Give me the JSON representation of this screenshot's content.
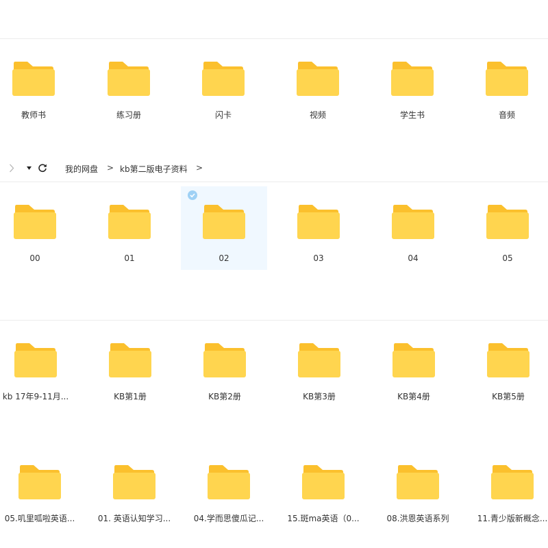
{
  "colors": {
    "folder_back": "#fbc02d",
    "folder_front": "#ffd54f",
    "selected_bg": "#f0f8ff",
    "check": "#9fd1f5"
  },
  "breadcrumb": {
    "items": [
      "我的网盘",
      "kb第二版电子资料"
    ],
    "separator": ">"
  },
  "toolbar": {
    "forward_icon": "chevron-right-icon",
    "dropdown_icon": "caret-down-icon",
    "refresh_icon": "refresh-icon"
  },
  "sections": [
    {
      "folders": [
        {
          "label": "教师书"
        },
        {
          "label": "练习册"
        },
        {
          "label": "闪卡"
        },
        {
          "label": "视频"
        },
        {
          "label": "学生书"
        },
        {
          "label": "音频"
        }
      ]
    },
    {
      "folders": [
        {
          "label": "00"
        },
        {
          "label": "01"
        },
        {
          "label": "02",
          "selected": true
        },
        {
          "label": "03"
        },
        {
          "label": "04"
        },
        {
          "label": "05"
        }
      ]
    },
    {
      "folders": [
        {
          "label": "kb 17年9-11月..."
        },
        {
          "label": "KB第1册"
        },
        {
          "label": "KB第2册"
        },
        {
          "label": "KB第3册"
        },
        {
          "label": "KB第4册"
        },
        {
          "label": "KB第5册"
        }
      ]
    },
    {
      "folders": [
        {
          "label": "05.叽里呱啦英语..."
        },
        {
          "label": "01. 英语认知学习..."
        },
        {
          "label": "04.学而思傻瓜记..."
        },
        {
          "label": "15.斑ma英语（0..."
        },
        {
          "label": "08.洪恩英语系列"
        },
        {
          "label": "11.青少版新概念..."
        }
      ]
    }
  ]
}
